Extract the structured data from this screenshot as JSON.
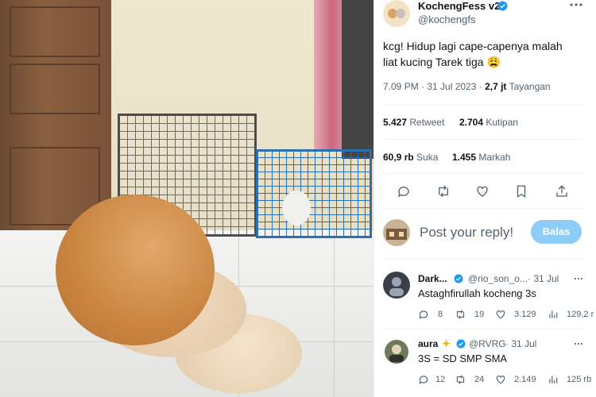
{
  "tweet": {
    "author_name": "KochengFess v2",
    "author_handle": "@kochengfs",
    "text_line1": "kcg! Hidup lagi cape-capenya malah",
    "text_line2": "liat kucing Tarek tiga 😩",
    "time": "7.09 PM · 31 Jul 2023 ·",
    "views_count": "2,7 jt",
    "views_label": "Tayangan",
    "retweet_count": "5.427",
    "retweet_label": "Retweet",
    "quote_count": "2.704",
    "quote_label": "Kutipan",
    "like_count": "60,9 rb",
    "like_label": "Suka",
    "bookmark_count": "1.455",
    "bookmark_label": "Markah"
  },
  "compose": {
    "placeholder": "Post your reply!",
    "button": "Balas"
  },
  "replies": [
    {
      "name": "Dark...",
      "handle": "@rio_son_o...",
      "date": "· 31 Jul",
      "text": "Astaghfirullah kocheng 3s",
      "replies": "8",
      "retweets": "19",
      "likes": "3.129",
      "views": "129,2 r"
    },
    {
      "name": "aura",
      "handle": "@RVRG",
      "date": "· 31 Jul",
      "text": "3S = SD SMP SMA",
      "replies": "12",
      "retweets": "24",
      "likes": "2.149",
      "views": "125 rb"
    }
  ],
  "colors": {
    "accent": "#1d9bf0",
    "reply_button": "#8ecdf8",
    "muted": "#536471",
    "verified": "#1d9bf0"
  },
  "icons": [
    "more-icon",
    "verified-icon",
    "reply-icon",
    "retweet-icon",
    "like-icon",
    "bookmark-icon",
    "share-icon",
    "views-icon"
  ]
}
